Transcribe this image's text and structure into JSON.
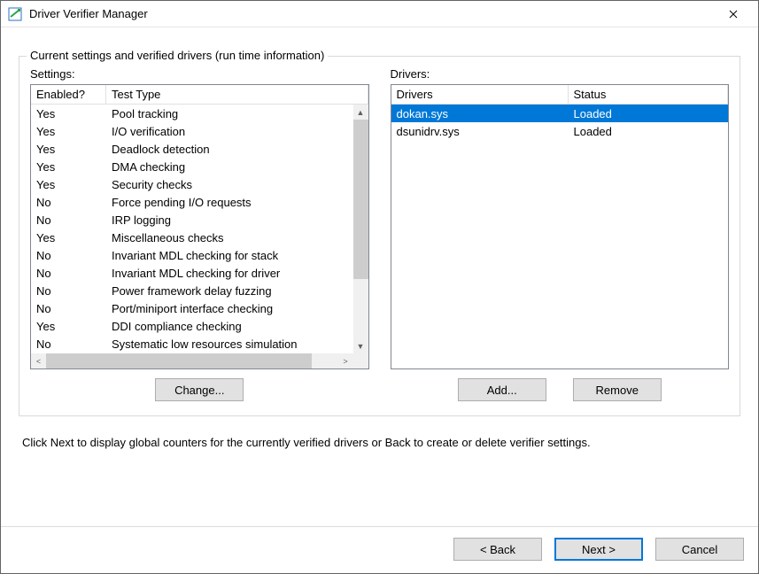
{
  "window": {
    "title": "Driver Verifier Manager"
  },
  "groupbox": {
    "legend": "Current settings and verified drivers (run time information)"
  },
  "settings": {
    "label": "Settings:",
    "headers": {
      "enabled": "Enabled?",
      "type": "Test Type"
    },
    "rows": [
      {
        "enabled": "Yes",
        "type": "Pool tracking"
      },
      {
        "enabled": "Yes",
        "type": "I/O verification"
      },
      {
        "enabled": "Yes",
        "type": "Deadlock detection"
      },
      {
        "enabled": "Yes",
        "type": "DMA checking"
      },
      {
        "enabled": "Yes",
        "type": "Security checks"
      },
      {
        "enabled": "No",
        "type": "Force pending I/O requests"
      },
      {
        "enabled": "No",
        "type": "IRP logging"
      },
      {
        "enabled": "Yes",
        "type": "Miscellaneous checks"
      },
      {
        "enabled": "No",
        "type": "Invariant MDL checking for stack"
      },
      {
        "enabled": "No",
        "type": "Invariant MDL checking for driver"
      },
      {
        "enabled": "No",
        "type": "Power framework delay fuzzing"
      },
      {
        "enabled": "No",
        "type": "Port/miniport interface checking"
      },
      {
        "enabled": "Yes",
        "type": "DDI compliance checking"
      },
      {
        "enabled": "No",
        "type": "Systematic low resources simulation"
      }
    ],
    "button": "Change..."
  },
  "drivers": {
    "label": "Drivers:",
    "headers": {
      "driver": "Drivers",
      "status": "Status"
    },
    "rows": [
      {
        "driver": "dokan.sys",
        "status": "Loaded",
        "selected": true
      },
      {
        "driver": "dsunidrv.sys",
        "status": "Loaded",
        "selected": false
      }
    ],
    "add_button": "Add...",
    "remove_button": "Remove"
  },
  "hint": "Click Next to display global counters for the currently verified drivers or Back to create or delete verifier settings.",
  "wizard": {
    "back": "< Back",
    "next": "Next >",
    "cancel": "Cancel"
  }
}
